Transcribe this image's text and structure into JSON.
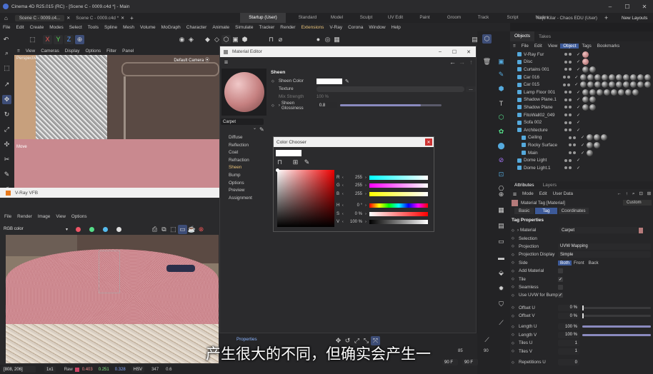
{
  "window": {
    "title": "Cinema 4D R25.015 (RC) - [Scene C - 0009.c4d *] - Main",
    "tab_scene": "Scene C - 0009.c4...",
    "tab_scene2": "Scene C - 0009.c4d *",
    "controls": [
      "–",
      "☐",
      "✕"
    ]
  },
  "layouts": {
    "items": [
      "Startup (User)",
      "Standard",
      "Model",
      "Sculpt",
      "UV Edit",
      "Paint",
      "Groom",
      "Track",
      "Script",
      "Nodes"
    ],
    "user": "Nejc Kilar - Chaos EDU (User)",
    "new_layouts": "New Layouts"
  },
  "menubar": [
    "File",
    "Edit",
    "Create",
    "Modes",
    "Select",
    "Tools",
    "Spline",
    "Mesh",
    "Volume",
    "MoGraph",
    "Character",
    "Animate",
    "Simulate",
    "Tracker",
    "Render",
    "Extensions",
    "V-Ray",
    "Corona",
    "Window",
    "Help"
  ],
  "toolbar": {
    "axis": [
      "X",
      "Y",
      "Z"
    ]
  },
  "viewport": {
    "menu": [
      "View",
      "Cameras",
      "Display",
      "Options",
      "Filter",
      "Panel"
    ],
    "label": "Perspective",
    "camera": "Default Camera ⦿",
    "move": "Move"
  },
  "vfb": {
    "title": "V-Ray VFB",
    "menu": [
      "File",
      "Render",
      "Image",
      "View",
      "Options"
    ],
    "channel": "RGB color",
    "status": {
      "coords": "[808, 206]",
      "scale": "1x1",
      "mode": "Raw",
      "r": "0.403",
      "g": "0.251",
      "b": "0.328",
      "space": "HSV",
      "h": "347",
      "s": "0.6"
    }
  },
  "material_editor": {
    "title": "Material Editor",
    "material_name": "Carpet",
    "channels": [
      "Diffuse",
      "Reflection",
      "Coat",
      "Refraction",
      "Sheen",
      "Bump",
      "Options",
      "Preview",
      "Assignment"
    ],
    "active_channel": "Sheen",
    "section": "Sheen",
    "sheen_color_label": "Sheen Color",
    "texture_label": "Texture",
    "mix_strength_label": "Mix Strength",
    "mix_strength_value": "100 %",
    "glossiness_label": "Sheen Glossiness",
    "glossiness_value": "0.8",
    "glossiness_fraction": 0.8
  },
  "color_chooser": {
    "title": "Color Chooser",
    "channels": [
      {
        "label": "R",
        "value": "255"
      },
      {
        "label": "G",
        "value": "255"
      },
      {
        "label": "B",
        "value": "255"
      },
      {
        "label": "H",
        "value": "0 °"
      },
      {
        "label": "S",
        "value": "0 %"
      },
      {
        "label": "V",
        "value": "100 %"
      }
    ]
  },
  "objects_panel": {
    "tabs": [
      "Objects",
      "Takes"
    ],
    "menu": [
      "File",
      "Edit",
      "View",
      "Object",
      "Tags",
      "Bookmarks"
    ],
    "items": [
      {
        "name": "V-Ray Fur",
        "indent": 0
      },
      {
        "name": "Disc",
        "indent": 0
      },
      {
        "name": "Curtains 001",
        "indent": 0
      },
      {
        "name": "Car 016",
        "indent": 0
      },
      {
        "name": "Car 015",
        "indent": 0
      },
      {
        "name": "Lamp Floor 001",
        "indent": 0
      },
      {
        "name": "Shadow Plane.1",
        "indent": 0
      },
      {
        "name": "Shadow Plane",
        "indent": 0
      },
      {
        "name": "FitoWall02_049",
        "indent": 0
      },
      {
        "name": "Sofa 002",
        "indent": 0
      },
      {
        "name": "Architecture",
        "indent": 0
      },
      {
        "name": "Ceiling",
        "indent": 1
      },
      {
        "name": "Rocky Surface",
        "indent": 1
      },
      {
        "name": "Main",
        "indent": 1
      },
      {
        "name": "Dome Light",
        "indent": 0
      },
      {
        "name": "Dome Light.1",
        "indent": 0
      }
    ]
  },
  "attributes": {
    "tabs": [
      "Attributes",
      "Layers"
    ],
    "menu": [
      "Mode",
      "Edit",
      "User Data"
    ],
    "header": "Material Tag [Material]",
    "custom": "Custom",
    "subtabs": [
      "Basic",
      "Tag",
      "Coordinates"
    ],
    "active_subtab": "Tag",
    "section": "Tag Properties",
    "material_label": "Material",
    "material_value": "Carpet",
    "selection_label": "Selection",
    "projection_label": "Projection",
    "projection_value": "UVW Mapping",
    "projection_display_label": "Projection Display",
    "projection_display_value": "Simple",
    "side_label": "Side",
    "side_options": [
      "Both",
      "Front",
      "Back"
    ],
    "add_material_label": "Add Material",
    "tile_label": "Tile",
    "seamless_label": "Seamless",
    "use_uvw_label": "Use UVW for Bump",
    "offset_u_label": "Offset U",
    "offset_u_value": "0 %",
    "offset_v_label": "Offset V",
    "offset_v_value": "0 %",
    "length_u_label": "Length U",
    "length_u_value": "100 %",
    "length_v_label": "Length V",
    "length_v_value": "100 %",
    "tiles_u_label": "Tiles U",
    "tiles_u_value": "1",
    "tiles_v_label": "Tiles V",
    "tiles_v_value": "1",
    "repetitions_u_label": "Repetitions U",
    "repetitions_u_value": "0"
  },
  "timeline": {
    "properties_tab": "Properties",
    "frame_end": "90 F",
    "frame_end2": "90 F",
    "ticks": [
      "85",
      "90"
    ]
  },
  "subtitle": "产生很大的不同，但确实会产生一",
  "colors": {
    "accent": "#4d8fd9",
    "sheen_selected": "#e8c27a",
    "floor": "#c9898f"
  }
}
